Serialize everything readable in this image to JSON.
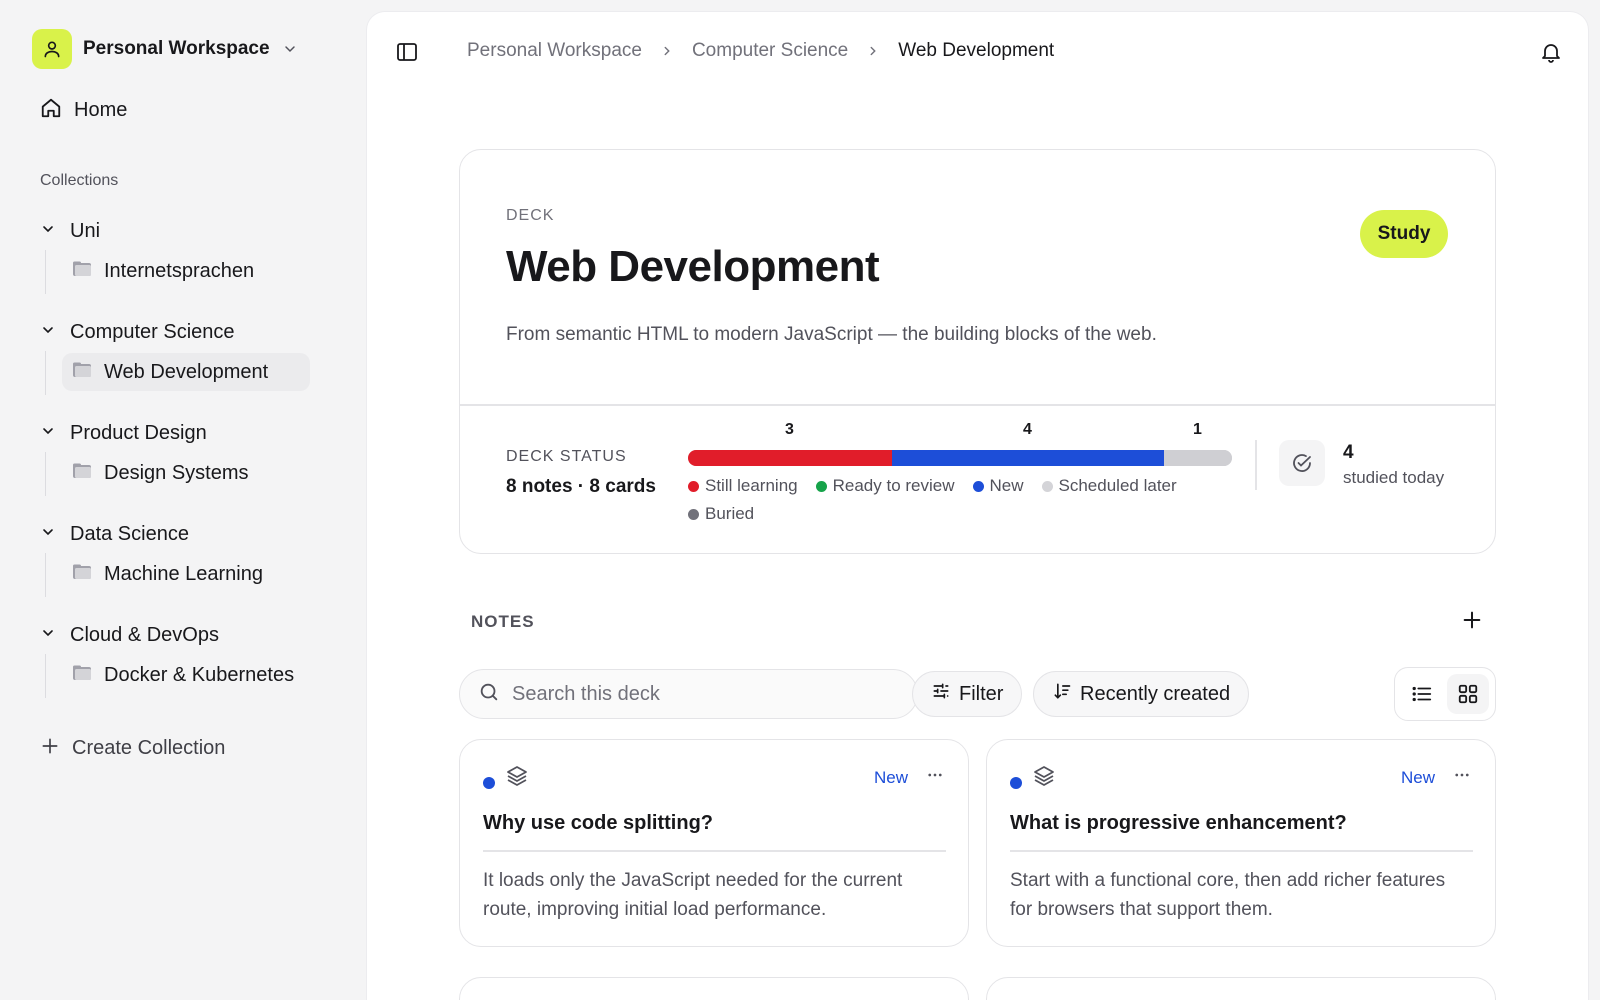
{
  "workspace": {
    "name": "Personal Workspace"
  },
  "nav": {
    "home": "Home"
  },
  "sidebar": {
    "collections_heading": "Collections",
    "collections": [
      {
        "name": "Uni",
        "decks": [
          "Internetsprachen"
        ]
      },
      {
        "name": "Computer Science",
        "decks": [
          "Web Development"
        ]
      },
      {
        "name": "Product Design",
        "decks": [
          "Design Systems"
        ]
      },
      {
        "name": "Data Science",
        "decks": [
          "Machine Learning"
        ]
      },
      {
        "name": "Cloud & DevOps",
        "decks": [
          "Docker & Kubernetes"
        ]
      }
    ],
    "active_deck": "Web Development",
    "create_label": "Create Collection"
  },
  "breadcrumb": [
    "Personal Workspace",
    "Computer Science",
    "Web Development"
  ],
  "deck": {
    "kicker": "DECK",
    "title": "Web Development",
    "description": "From semantic HTML to modern JavaScript — the building blocks of the web.",
    "study_label": "Study",
    "status_label": "DECK STATUS",
    "counts": "8 notes · 8 cards",
    "progress": [
      {
        "label": "Still learning",
        "value": 3,
        "color": "#e11d2a"
      },
      {
        "label": "New",
        "value": 4,
        "color": "#1d4ed8"
      },
      {
        "label": "Scheduled later",
        "value": 1,
        "color": "#cfcfd3"
      }
    ],
    "legend": [
      {
        "label": "Still learning",
        "color": "#e11d2a"
      },
      {
        "label": "Ready to review",
        "color": "#16a34a"
      },
      {
        "label": "New",
        "color": "#1d4ed8"
      },
      {
        "label": "Scheduled later",
        "color": "#d4d4d8"
      },
      {
        "label": "Buried",
        "color": "#71717a"
      }
    ],
    "studied_today_count": "4",
    "studied_today_label": "studied today"
  },
  "notes": {
    "heading": "NOTES",
    "search_placeholder": "Search this deck",
    "filter_label": "Filter",
    "sort_label": "Recently created",
    "view_mode": "grid",
    "items": [
      {
        "status": "New",
        "question": "Why use code splitting?",
        "answer": "It loads only the JavaScript needed for the current route, improving initial load performance."
      },
      {
        "status": "New",
        "question": "What is progressive enhancement?",
        "answer": "Start with a functional core, then add richer features for browsers that support them."
      }
    ]
  },
  "colors": {
    "accent": "#d9f24a",
    "new": "#1d4ed8"
  }
}
